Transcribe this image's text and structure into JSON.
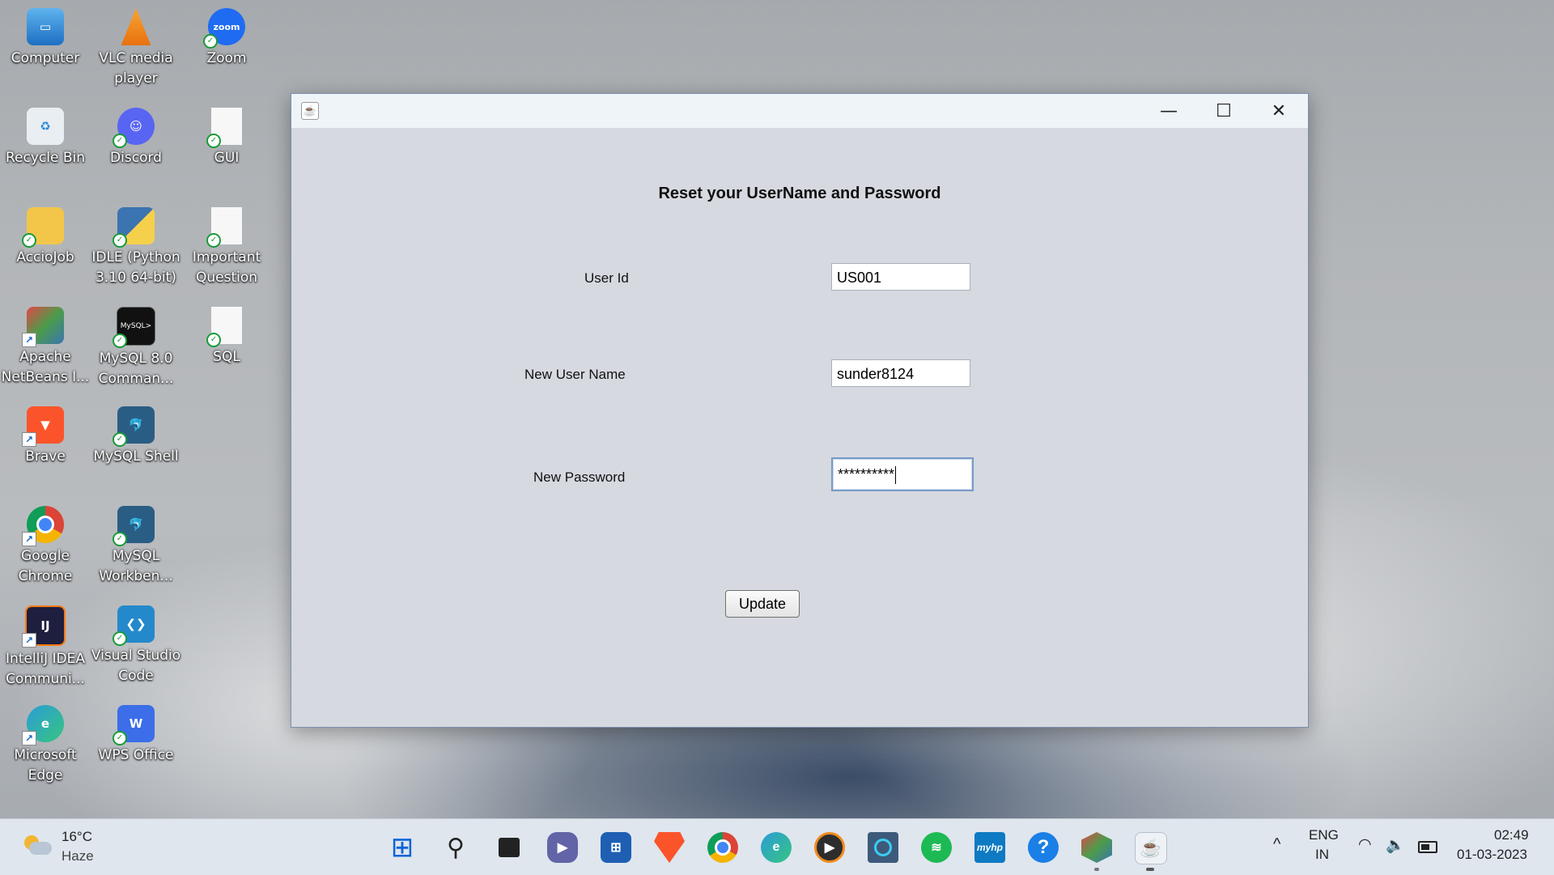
{
  "desktop": {
    "icons": [
      {
        "label_1": "Computer",
        "label_2": "",
        "color": "#2b8ad8",
        "icon": "computer-icon"
      },
      {
        "label_1": "VLC media",
        "label_2": "player",
        "color": "#f08a1c",
        "icon": "vlc-icon"
      },
      {
        "label_1": "Zoom",
        "label_2": "",
        "color": "#1f6bf2",
        "icon": "zoom-icon"
      },
      {
        "label_1": "Recycle Bin",
        "label_2": "",
        "color": "#cfd8e0",
        "icon": "recycle-bin-icon"
      },
      {
        "label_1": "Discord",
        "label_2": "",
        "color": "#5865f2",
        "icon": "discord-icon"
      },
      {
        "label_1": "GUI",
        "label_2": "",
        "color": "#f4f4f4",
        "icon": "document-icon"
      },
      {
        "label_1": "AccioJob",
        "label_2": "",
        "color": "#f3c64a",
        "icon": "folder-icon"
      },
      {
        "label_1": "IDLE (Python",
        "label_2": "3.10 64-bit)",
        "color": "#3b74b0",
        "icon": "python-icon"
      },
      {
        "label_1": "Important",
        "label_2": "Question",
        "color": "#f4f4f4",
        "icon": "document-icon"
      },
      {
        "label_1": "Apache",
        "label_2": "NetBeans I...",
        "color": "#4c9c4a",
        "icon": "netbeans-icon"
      },
      {
        "label_1": "MySQL 8.0",
        "label_2": "Comman...",
        "color": "#1d1d1d",
        "icon": "mysql-command-icon"
      },
      {
        "label_1": "SQL",
        "label_2": "",
        "color": "#f4f4f4",
        "icon": "document-icon"
      },
      {
        "label_1": "Brave",
        "label_2": "",
        "color": "#fb542b",
        "icon": "brave-icon"
      },
      {
        "label_1": "MySQL Shell",
        "label_2": "",
        "color": "#2a5d84",
        "icon": "mysql-shell-icon"
      },
      {
        "label_1": "Google",
        "label_2": "Chrome",
        "color": "#db4437",
        "icon": "chrome-icon"
      },
      {
        "label_1": "MySQL",
        "label_2": "Workben...",
        "color": "#2a5d84",
        "icon": "mysql-workbench-icon"
      },
      {
        "label_1": "IntelliJ IDEA",
        "label_2": "Communi...",
        "color": "#1e1e3f",
        "icon": "intellij-icon"
      },
      {
        "label_1": "Visual Studio",
        "label_2": "Code",
        "color": "#2489ca",
        "icon": "vscode-icon"
      },
      {
        "label_1": "Microsoft",
        "label_2": "Edge",
        "color": "#2a9dd6",
        "icon": "edge-icon"
      },
      {
        "label_1": "WPS Office",
        "label_2": "",
        "color": "#3b6ee8",
        "icon": "wps-icon"
      }
    ]
  },
  "window": {
    "title": "",
    "minimize": "—",
    "maximize": "☐",
    "close": "✕",
    "heading": "Reset your UserName and Password",
    "fields": {
      "user_id": {
        "label": "User Id",
        "value": "US001"
      },
      "new_user_name": {
        "label": "New User Name",
        "value": "sunder8124"
      },
      "new_password": {
        "label": "New Password",
        "value": "**********"
      }
    },
    "update_label": "Update"
  },
  "taskbar": {
    "weather_temp": "16°C",
    "weather_desc": "Haze",
    "lang_1": "ENG",
    "lang_2": "IN",
    "time": "02:49",
    "date": "01-03-2023",
    "chevron": "^",
    "apps": [
      "start-icon",
      "search-icon",
      "task-view-icon",
      "teams-icon",
      "store-icon",
      "brave-icon",
      "chrome-icon",
      "edge-icon",
      "media-player-icon",
      "alexa-icon",
      "spotify-icon",
      "myhp-icon",
      "help-icon",
      "netbeans-icon",
      "java-icon"
    ]
  }
}
